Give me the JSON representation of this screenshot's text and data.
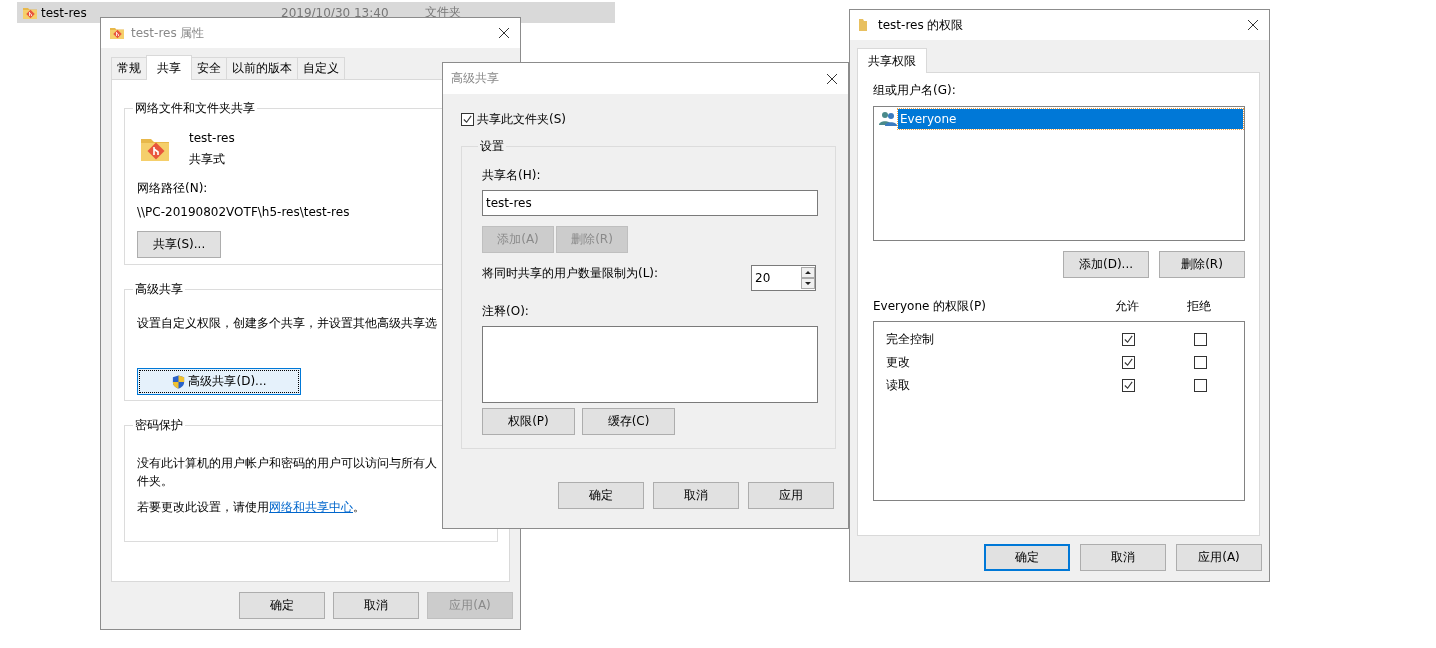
{
  "explorer_row": {
    "name": "test-res",
    "date": "2019/10/30 13:40",
    "type": "文件夹",
    "selected": true
  },
  "properties_window": {
    "title": "test-res 属性",
    "tabs": [
      {
        "label": "常规",
        "selected": false
      },
      {
        "label": "共享",
        "selected": true
      },
      {
        "label": "安全",
        "selected": false
      },
      {
        "label": "以前的版本",
        "selected": false
      },
      {
        "label": "自定义",
        "selected": false
      }
    ],
    "network_sharing": {
      "heading": "网络文件和文件夹共享",
      "folder_name": "test-res",
      "status": "共享式",
      "path_label": "网络路径(N):",
      "path": "\\\\PC-20190802VOTF\\h5-res\\test-res",
      "share_button": "共享(S)..."
    },
    "advanced_sharing": {
      "heading": "高级共享",
      "description": "设置自定义权限，创建多个共享，并设置其他高级共享选",
      "button": {
        "label": "高级共享(D)...",
        "focused": true
      }
    },
    "password_protection": {
      "heading": "密码保护",
      "description_lines": [
        "没有此计算机的用户帐户和密码的用户可以访问与所有人",
        "件夹。"
      ],
      "link_prefix": "若要更改此设置，请使用",
      "link": "网络和共享中心",
      "link_suffix": "。"
    },
    "buttons": [
      {
        "label": "确定",
        "disabled": false
      },
      {
        "label": "取消",
        "disabled": false
      },
      {
        "label": "应用(A)",
        "disabled": true
      }
    ]
  },
  "advanced_sharing_dialog": {
    "title": "高级共享",
    "share_checkbox": {
      "label": "共享此文件夹(S)",
      "checked": true
    },
    "settings_heading": "设置",
    "share_name_label": "共享名(H):",
    "share_name": "test-res",
    "name_buttons": [
      {
        "label": "添加(A)",
        "disabled": true
      },
      {
        "label": "删除(R)",
        "disabled": true
      }
    ],
    "limit_label": "将同时共享的用户数量限制为(L):",
    "limit_value": "20",
    "comment_label": "注释(O):",
    "option_buttons": [
      {
        "label": "权限(P)",
        "disabled": false
      },
      {
        "label": "缓存(C)",
        "disabled": false
      }
    ],
    "buttons": [
      {
        "label": "确定",
        "disabled": false
      },
      {
        "label": "取消",
        "disabled": false
      },
      {
        "label": "应用",
        "disabled": false
      }
    ]
  },
  "permissions_window": {
    "title": "test-res 的权限",
    "tabs": [
      {
        "label": "共享权限",
        "selected": true
      }
    ],
    "users_label": "组或用户名(G):",
    "users": [
      {
        "name": "Everyone",
        "selected": true
      }
    ],
    "user_buttons": [
      {
        "label": "添加(D)...",
        "default": false
      },
      {
        "label": "删除(R)",
        "default": false
      }
    ],
    "permissions_label": "Everyone 的权限(P)",
    "allow_header": "允许",
    "deny_header": "拒绝",
    "permissions": [
      {
        "name": "完全控制",
        "allow": true,
        "deny": false
      },
      {
        "name": "更改",
        "allow": true,
        "deny": false
      },
      {
        "name": "读取",
        "allow": true,
        "deny": false
      }
    ],
    "buttons": [
      {
        "label": "确定",
        "default": true
      },
      {
        "label": "取消",
        "default": false
      },
      {
        "label": "应用(A)",
        "default": false
      }
    ]
  }
}
